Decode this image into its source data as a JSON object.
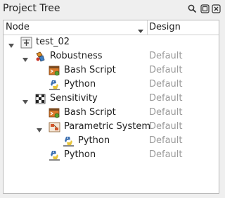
{
  "window": {
    "title": "Project Tree",
    "buttons": [
      "search-icon",
      "float-icon",
      "close-icon"
    ]
  },
  "columns": {
    "node": "Node",
    "design": "Design"
  },
  "tree": [
    {
      "label": "test_02",
      "design": "",
      "depth": 0,
      "expanded": true,
      "icon": "project-icon"
    },
    {
      "label": "Robustness",
      "design": "Default",
      "depth": 1,
      "expanded": true,
      "icon": "robustness-icon"
    },
    {
      "label": "Bash Script",
      "design": "Default",
      "depth": 2,
      "expanded": null,
      "icon": "bash-script-icon"
    },
    {
      "label": "Python",
      "design": "Default",
      "depth": 2,
      "expanded": null,
      "icon": "python-icon"
    },
    {
      "label": "Sensitivity",
      "design": "Default",
      "depth": 1,
      "expanded": true,
      "icon": "sensitivity-icon"
    },
    {
      "label": "Bash Script",
      "design": "Default",
      "depth": 2,
      "expanded": null,
      "icon": "bash-script-icon"
    },
    {
      "label": "Parametric System",
      "design": "Default",
      "depth": 2,
      "expanded": true,
      "icon": "parametric-system-icon"
    },
    {
      "label": "Python",
      "design": "Default",
      "depth": 3,
      "expanded": null,
      "icon": "python-icon"
    },
    {
      "label": "Python",
      "design": "Default",
      "depth": 2,
      "expanded": null,
      "icon": "python-icon"
    }
  ]
}
